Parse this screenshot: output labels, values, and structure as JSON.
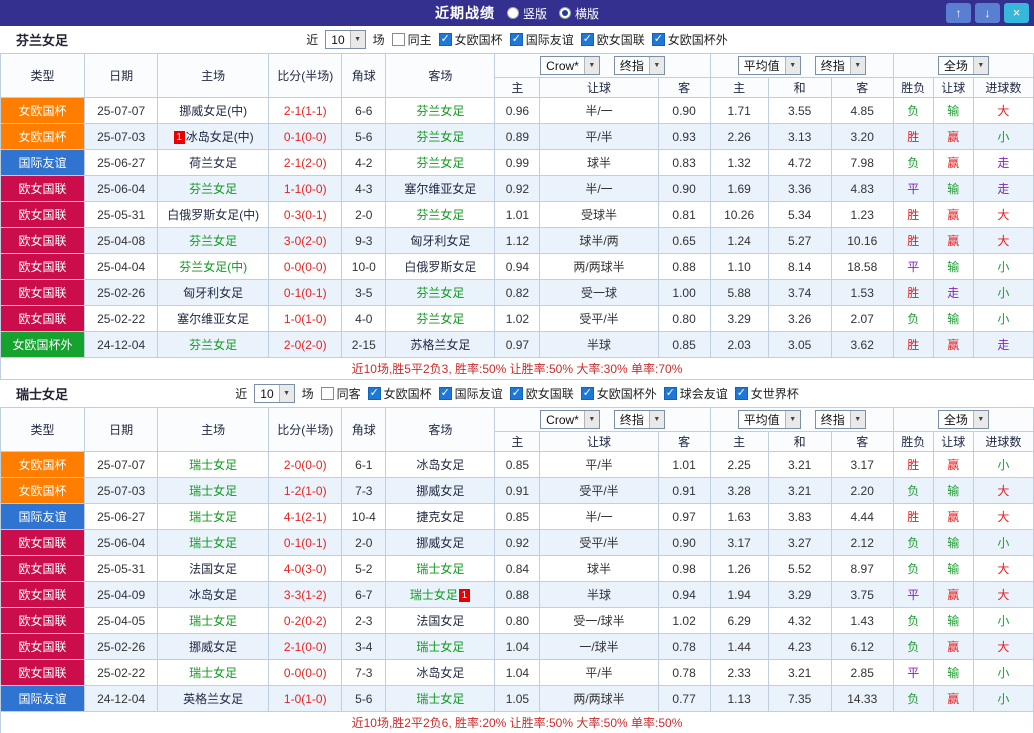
{
  "topbar": {
    "title": "近期战绩",
    "radios": [
      {
        "label": "竖版",
        "selected": false
      },
      {
        "label": "横版",
        "selected": true
      }
    ],
    "buttons": {
      "up": "↑",
      "down": "↓",
      "close": "×"
    }
  },
  "table_header": {
    "main_cols": [
      "类型",
      "日期",
      "主场",
      "比分(半场)",
      "角球",
      "客场"
    ],
    "sub_cols": [
      "主",
      "让球",
      "客",
      "主",
      "和",
      "客",
      "胜负",
      "让球",
      "进球数"
    ],
    "book_select": "Crow*",
    "final_select": "终指",
    "avg_select": "平均值",
    "final_select2": "终指",
    "scope_select": "全场"
  },
  "type_colors": {
    "女欧国杯": "#ff7e00",
    "国际友谊": "#2f74d0",
    "欧女国联": "#cb0e4b",
    "女欧国杯外": "#15a22f"
  },
  "result_colors": {
    "胜": "#e81c1c",
    "赢": "#e81c1c",
    "大": "#e81c1c",
    "负": "#1d9e31",
    "输": "#1d9e31",
    "小": "#1d9e31",
    "平": "#8822bb",
    "走": "#8822bb"
  },
  "sections": [
    {
      "team": "芬兰女足",
      "near_label": "近",
      "count": "10",
      "games_label": "场",
      "same_checkbox": {
        "label": "同主",
        "checked": false
      },
      "league_checkboxes": [
        {
          "label": "女欧国杯",
          "checked": true
        },
        {
          "label": "国际友谊",
          "checked": true
        },
        {
          "label": "欧女国联",
          "checked": true
        },
        {
          "label": "女欧国杯外",
          "checked": true
        }
      ],
      "rows": [
        {
          "type": "女欧国杯",
          "date": "25-07-07",
          "home": "挪威女足(中)",
          "home_focal": false,
          "home_badge": "",
          "score": "2-1(1-1)",
          "corner": "6-6",
          "away": "芬兰女足",
          "away_focal": true,
          "away_badge": "",
          "odds": [
            "0.96",
            "半/一",
            "0.90"
          ],
          "avg": [
            "1.71",
            "3.55",
            "4.85"
          ],
          "results": [
            "负",
            "输",
            "大"
          ]
        },
        {
          "type": "女欧国杯",
          "date": "25-07-03",
          "home": "冰岛女足(中)",
          "home_focal": false,
          "home_badge": "1",
          "score": "0-1(0-0)",
          "corner": "5-6",
          "away": "芬兰女足",
          "away_focal": true,
          "away_badge": "",
          "odds": [
            "0.89",
            "平/半",
            "0.93"
          ],
          "avg": [
            "2.26",
            "3.13",
            "3.20"
          ],
          "results": [
            "胜",
            "赢",
            "小"
          ]
        },
        {
          "type": "国际友谊",
          "date": "25-06-27",
          "home": "荷兰女足",
          "home_focal": false,
          "home_badge": "",
          "score": "2-1(2-0)",
          "corner": "4-2",
          "away": "芬兰女足",
          "away_focal": true,
          "away_badge": "",
          "odds": [
            "0.99",
            "球半",
            "0.83"
          ],
          "avg": [
            "1.32",
            "4.72",
            "7.98"
          ],
          "results": [
            "负",
            "赢",
            "走"
          ]
        },
        {
          "type": "欧女国联",
          "date": "25-06-04",
          "home": "芬兰女足",
          "home_focal": true,
          "home_badge": "",
          "score": "1-1(0-0)",
          "corner": "4-3",
          "away": "塞尔维亚女足",
          "away_focal": false,
          "away_badge": "",
          "odds": [
            "0.92",
            "半/一",
            "0.90"
          ],
          "avg": [
            "1.69",
            "3.36",
            "4.83"
          ],
          "results": [
            "平",
            "输",
            "走"
          ]
        },
        {
          "type": "欧女国联",
          "date": "25-05-31",
          "home": "白俄罗斯女足(中)",
          "home_focal": false,
          "home_badge": "",
          "score": "0-3(0-1)",
          "corner": "2-0",
          "away": "芬兰女足",
          "away_focal": true,
          "away_badge": "",
          "odds": [
            "1.01",
            "受球半",
            "0.81"
          ],
          "avg": [
            "10.26",
            "5.34",
            "1.23"
          ],
          "results": [
            "胜",
            "赢",
            "大"
          ]
        },
        {
          "type": "欧女国联",
          "date": "25-04-08",
          "home": "芬兰女足",
          "home_focal": true,
          "home_badge": "",
          "score": "3-0(2-0)",
          "corner": "9-3",
          "away": "匈牙利女足",
          "away_focal": false,
          "away_badge": "",
          "odds": [
            "1.12",
            "球半/两",
            "0.65"
          ],
          "avg": [
            "1.24",
            "5.27",
            "10.16"
          ],
          "results": [
            "胜",
            "赢",
            "大"
          ]
        },
        {
          "type": "欧女国联",
          "date": "25-04-04",
          "home": "芬兰女足(中)",
          "home_focal": true,
          "home_badge": "",
          "score": "0-0(0-0)",
          "corner": "10-0",
          "away": "白俄罗斯女足",
          "away_focal": false,
          "away_badge": "",
          "odds": [
            "0.94",
            "两/两球半",
            "0.88"
          ],
          "avg": [
            "1.10",
            "8.14",
            "18.58"
          ],
          "results": [
            "平",
            "输",
            "小"
          ]
        },
        {
          "type": "欧女国联",
          "date": "25-02-26",
          "home": "匈牙利女足",
          "home_focal": false,
          "home_badge": "",
          "score": "0-1(0-1)",
          "corner": "3-5",
          "away": "芬兰女足",
          "away_focal": true,
          "away_badge": "",
          "odds": [
            "0.82",
            "受一球",
            "1.00"
          ],
          "avg": [
            "5.88",
            "3.74",
            "1.53"
          ],
          "results": [
            "胜",
            "走",
            "小"
          ]
        },
        {
          "type": "欧女国联",
          "date": "25-02-22",
          "home": "塞尔维亚女足",
          "home_focal": false,
          "home_badge": "",
          "score": "1-0(1-0)",
          "corner": "4-0",
          "away": "芬兰女足",
          "away_focal": true,
          "away_badge": "",
          "odds": [
            "1.02",
            "受平/半",
            "0.80"
          ],
          "avg": [
            "3.29",
            "3.26",
            "2.07"
          ],
          "results": [
            "负",
            "输",
            "小"
          ]
        },
        {
          "type": "女欧国杯外",
          "date": "24-12-04",
          "home": "芬兰女足",
          "home_focal": true,
          "home_badge": "",
          "score": "2-0(2-0)",
          "corner": "2-15",
          "away": "苏格兰女足",
          "away_focal": false,
          "away_badge": "",
          "odds": [
            "0.97",
            "半球",
            "0.85"
          ],
          "avg": [
            "2.03",
            "3.05",
            "3.62"
          ],
          "results": [
            "胜",
            "赢",
            "走"
          ]
        }
      ],
      "summary": "近10场,胜5平2负3, 胜率:50% 让胜率:50% 大率:30% 单率:70%"
    },
    {
      "team": "瑞士女足",
      "near_label": "近",
      "count": "10",
      "games_label": "场",
      "same_checkbox": {
        "label": "同客",
        "checked": false
      },
      "league_checkboxes": [
        {
          "label": "女欧国杯",
          "checked": true
        },
        {
          "label": "国际友谊",
          "checked": true
        },
        {
          "label": "欧女国联",
          "checked": true
        },
        {
          "label": "女欧国杯外",
          "checked": true
        },
        {
          "label": "球会友谊",
          "checked": true
        },
        {
          "label": "女世界杯",
          "checked": true
        }
      ],
      "rows": [
        {
          "type": "女欧国杯",
          "date": "25-07-07",
          "home": "瑞士女足",
          "home_focal": true,
          "home_badge": "",
          "score": "2-0(0-0)",
          "corner": "6-1",
          "away": "冰岛女足",
          "away_focal": false,
          "away_badge": "",
          "odds": [
            "0.85",
            "平/半",
            "1.01"
          ],
          "avg": [
            "2.25",
            "3.21",
            "3.17"
          ],
          "results": [
            "胜",
            "赢",
            "小"
          ]
        },
        {
          "type": "女欧国杯",
          "date": "25-07-03",
          "home": "瑞士女足",
          "home_focal": true,
          "home_badge": "",
          "score": "1-2(1-0)",
          "corner": "7-3",
          "away": "挪威女足",
          "away_focal": false,
          "away_badge": "",
          "odds": [
            "0.91",
            "受平/半",
            "0.91"
          ],
          "avg": [
            "3.28",
            "3.21",
            "2.20"
          ],
          "results": [
            "负",
            "输",
            "大"
          ]
        },
        {
          "type": "国际友谊",
          "date": "25-06-27",
          "home": "瑞士女足",
          "home_focal": true,
          "home_badge": "",
          "score": "4-1(2-1)",
          "corner": "10-4",
          "away": "捷克女足",
          "away_focal": false,
          "away_badge": "",
          "odds": [
            "0.85",
            "半/一",
            "0.97"
          ],
          "avg": [
            "1.63",
            "3.83",
            "4.44"
          ],
          "results": [
            "胜",
            "赢",
            "大"
          ]
        },
        {
          "type": "欧女国联",
          "date": "25-06-04",
          "home": "瑞士女足",
          "home_focal": true,
          "home_badge": "",
          "score": "0-1(0-1)",
          "corner": "2-0",
          "away": "挪威女足",
          "away_focal": false,
          "away_badge": "",
          "odds": [
            "0.92",
            "受平/半",
            "0.90"
          ],
          "avg": [
            "3.17",
            "3.27",
            "2.12"
          ],
          "results": [
            "负",
            "输",
            "小"
          ]
        },
        {
          "type": "欧女国联",
          "date": "25-05-31",
          "home": "法国女足",
          "home_focal": false,
          "home_badge": "",
          "score": "4-0(3-0)",
          "corner": "5-2",
          "away": "瑞士女足",
          "away_focal": true,
          "away_badge": "",
          "odds": [
            "0.84",
            "球半",
            "0.98"
          ],
          "avg": [
            "1.26",
            "5.52",
            "8.97"
          ],
          "results": [
            "负",
            "输",
            "大"
          ]
        },
        {
          "type": "欧女国联",
          "date": "25-04-09",
          "home": "冰岛女足",
          "home_focal": false,
          "home_badge": "",
          "score": "3-3(1-2)",
          "corner": "6-7",
          "away": "瑞士女足",
          "away_focal": true,
          "away_badge": "1",
          "odds": [
            "0.88",
            "半球",
            "0.94"
          ],
          "avg": [
            "1.94",
            "3.29",
            "3.75"
          ],
          "results": [
            "平",
            "赢",
            "大"
          ]
        },
        {
          "type": "欧女国联",
          "date": "25-04-05",
          "home": "瑞士女足",
          "home_focal": true,
          "home_badge": "",
          "score": "0-2(0-2)",
          "corner": "2-3",
          "away": "法国女足",
          "away_focal": false,
          "away_badge": "",
          "odds": [
            "0.80",
            "受一/球半",
            "1.02"
          ],
          "avg": [
            "6.29",
            "4.32",
            "1.43"
          ],
          "results": [
            "负",
            "输",
            "小"
          ]
        },
        {
          "type": "欧女国联",
          "date": "25-02-26",
          "home": "挪威女足",
          "home_focal": false,
          "home_badge": "",
          "score": "2-1(0-0)",
          "corner": "3-4",
          "away": "瑞士女足",
          "away_focal": true,
          "away_badge": "",
          "odds": [
            "1.04",
            "一/球半",
            "0.78"
          ],
          "avg": [
            "1.44",
            "4.23",
            "6.12"
          ],
          "results": [
            "负",
            "赢",
            "大"
          ]
        },
        {
          "type": "欧女国联",
          "date": "25-02-22",
          "home": "瑞士女足",
          "home_focal": true,
          "home_badge": "",
          "score": "0-0(0-0)",
          "corner": "7-3",
          "away": "冰岛女足",
          "away_focal": false,
          "away_badge": "",
          "odds": [
            "1.04",
            "平/半",
            "0.78"
          ],
          "avg": [
            "2.33",
            "3.21",
            "2.85"
          ],
          "results": [
            "平",
            "输",
            "小"
          ]
        },
        {
          "type": "国际友谊",
          "date": "24-12-04",
          "home": "英格兰女足",
          "home_focal": false,
          "home_badge": "",
          "score": "1-0(1-0)",
          "corner": "5-6",
          "away": "瑞士女足",
          "away_focal": true,
          "away_badge": "",
          "odds": [
            "1.05",
            "两/两球半",
            "0.77"
          ],
          "avg": [
            "1.13",
            "7.35",
            "14.33"
          ],
          "results": [
            "负",
            "赢",
            "小"
          ]
        }
      ],
      "summary": "近10场,胜2平2负6, 胜率:20% 让胜率:50% 大率:50% 单率:50%"
    }
  ]
}
